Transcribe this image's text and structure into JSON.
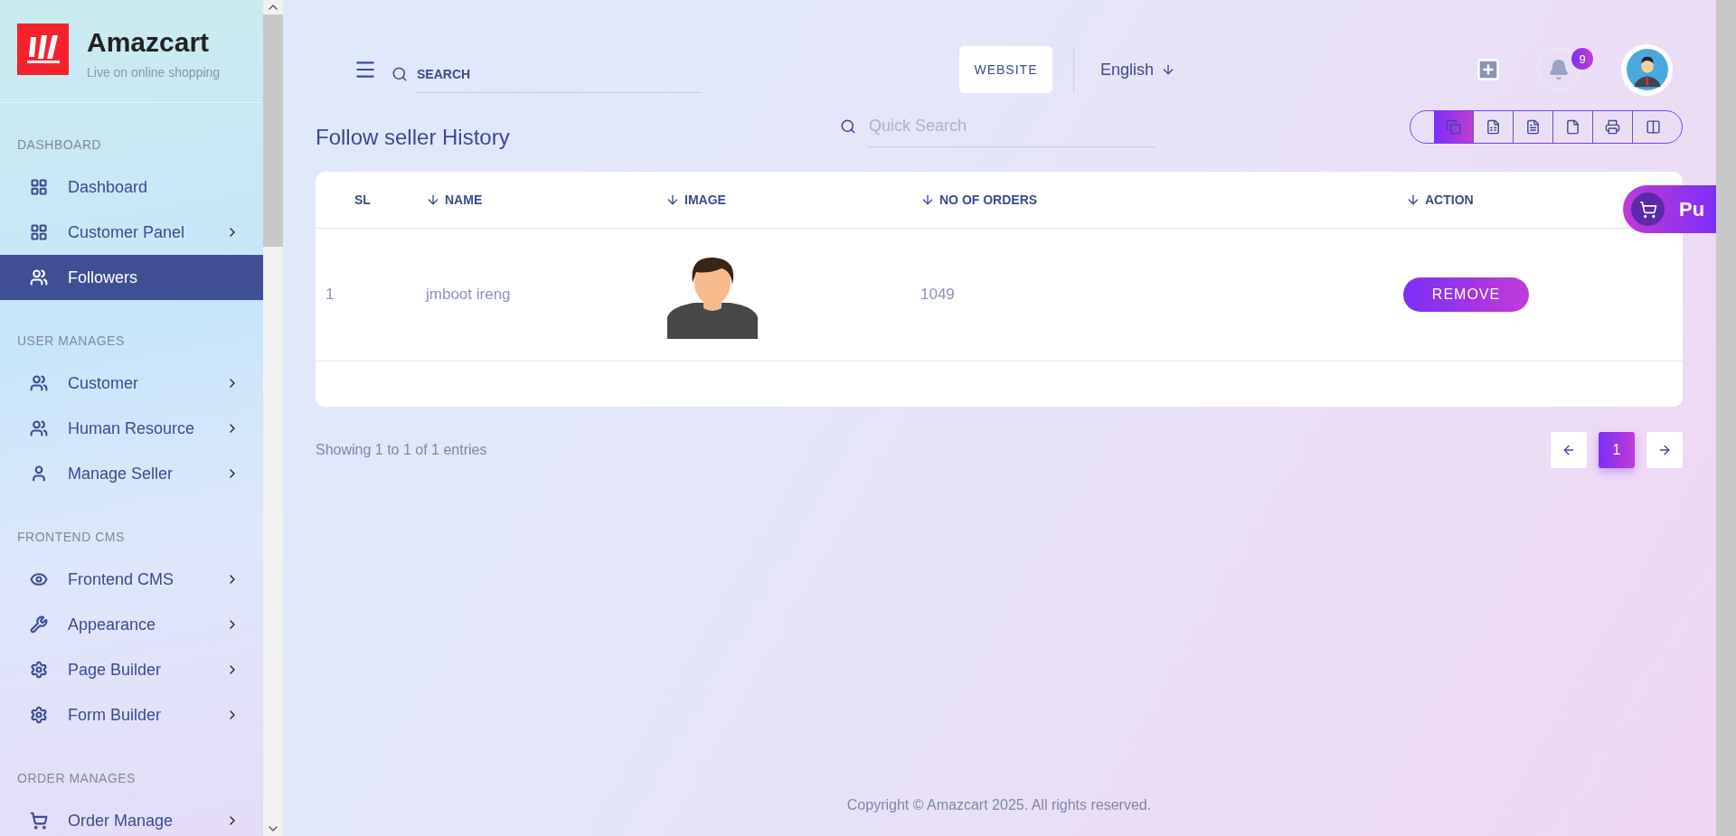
{
  "brand": {
    "name": "Amazcart",
    "tagline": "Live on online shopping"
  },
  "sidebar": {
    "sections": [
      {
        "title": "DASHBOARD",
        "items": [
          {
            "label": "Dashboard",
            "selected": false,
            "expandable": false
          },
          {
            "label": "Customer Panel",
            "selected": false,
            "expandable": true
          },
          {
            "label": "Followers",
            "selected": true,
            "expandable": false
          }
        ]
      },
      {
        "title": "USER MANAGES",
        "items": [
          {
            "label": "Customer",
            "selected": false,
            "expandable": true
          },
          {
            "label": "Human Resource",
            "selected": false,
            "expandable": true
          },
          {
            "label": "Manage Seller",
            "selected": false,
            "expandable": true
          }
        ]
      },
      {
        "title": "FRONTEND CMS",
        "items": [
          {
            "label": "Frontend CMS",
            "selected": false,
            "expandable": true
          },
          {
            "label": "Appearance",
            "selected": false,
            "expandable": true
          },
          {
            "label": "Page Builder",
            "selected": false,
            "expandable": true
          },
          {
            "label": "Form Builder",
            "selected": false,
            "expandable": true
          }
        ]
      },
      {
        "title": "ORDER MANAGES",
        "items": [
          {
            "label": "Order Manage",
            "selected": false,
            "expandable": true
          }
        ]
      }
    ]
  },
  "topbar": {
    "search": {
      "placeholder": "SEARCH"
    },
    "website_button": "WEBSITE",
    "language": "English",
    "notifications": {
      "count": "9"
    }
  },
  "page": {
    "title": "Follow seller History",
    "quick_search": {
      "placeholder": "Quick Search"
    },
    "export_buttons": [
      {
        "kind": "copy",
        "selected": true
      },
      {
        "kind": "excel",
        "selected": false
      },
      {
        "kind": "csv",
        "selected": false
      },
      {
        "kind": "pdf",
        "selected": false
      },
      {
        "kind": "print",
        "selected": false
      },
      {
        "kind": "columns",
        "selected": false
      }
    ]
  },
  "table": {
    "columns": [
      {
        "label": "SL",
        "sortable": false
      },
      {
        "label": "NAME",
        "sortable": true
      },
      {
        "label": "IMAGE",
        "sortable": true
      },
      {
        "label": "NO OF ORDERS",
        "sortable": true
      },
      {
        "label": "ACTION",
        "sortable": true
      }
    ],
    "rows": [
      {
        "sl": "1",
        "name": "jmboot ireng",
        "orders": "1049",
        "action": "REMOVE"
      }
    ]
  },
  "floating_button": {
    "label": "Pu"
  },
  "pagination": {
    "info": "Showing 1 to 1 of 1 entries",
    "pages": [
      {
        "label": "1",
        "selected": true
      }
    ]
  },
  "footer": {
    "copyright": "Copyright © Amazcart 2025. All rights reserved."
  }
}
